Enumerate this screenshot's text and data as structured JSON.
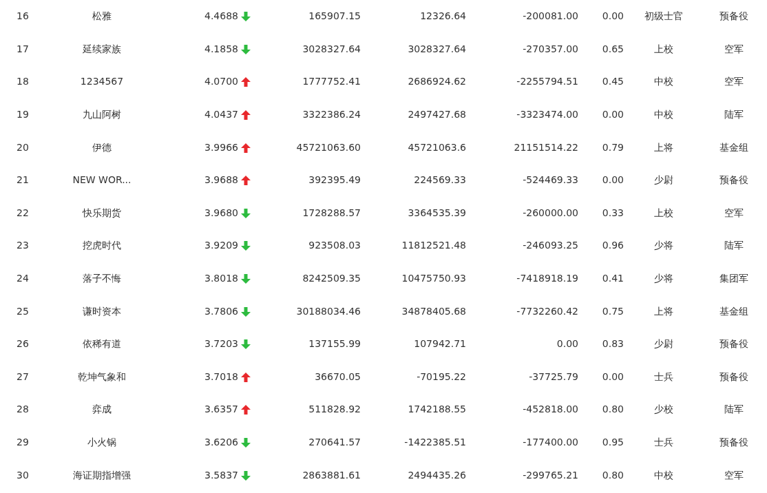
{
  "table": {
    "rows": [
      {
        "rank": "16",
        "name": "松雅",
        "score": "4.4688",
        "rising": false,
        "column_5": "165907.15",
        "column_6": "12326.64",
        "column_7": "-200081.00",
        "column_8": "0.00",
        "column_9": "初级士官",
        "column_10": "预备役"
      },
      {
        "rank": "17",
        "name": "延续家族",
        "score": "4.1858",
        "rising": false,
        "column_5": "3028327.64",
        "column_6": "3028327.64",
        "column_7": "-270357.00",
        "column_8": "0.65",
        "column_9": "上校",
        "column_10": "空军"
      },
      {
        "rank": "18",
        "name": "1234567",
        "score": "4.0700",
        "rising": true,
        "column_5": "1777752.41",
        "column_6": "2686924.62",
        "column_7": "-2255794.51",
        "column_8": "0.45",
        "column_9": "中校",
        "column_10": "空军"
      },
      {
        "rank": "19",
        "name": "九山阿树",
        "score": "4.0437",
        "rising": true,
        "column_5": "3322386.24",
        "column_6": "2497427.68",
        "column_7": "-3323474.00",
        "column_8": "0.00",
        "column_9": "中校",
        "column_10": "陆军"
      },
      {
        "rank": "20",
        "name": "伊德",
        "score": "3.9966",
        "rising": true,
        "column_5": "45721063.60",
        "column_6": "45721063.6",
        "column_7": "21151514.22",
        "column_8": "0.79",
        "column_9": "上将",
        "column_10": "基金组"
      },
      {
        "rank": "21",
        "name": "NEW WOR...",
        "score": "3.9688",
        "rising": true,
        "column_5": "392395.49",
        "column_6": "224569.33",
        "column_7": "-524469.33",
        "column_8": "0.00",
        "column_9": "少尉",
        "column_10": "预备役"
      },
      {
        "rank": "22",
        "name": "快乐期货",
        "score": "3.9680",
        "rising": false,
        "column_5": "1728288.57",
        "column_6": "3364535.39",
        "column_7": "-260000.00",
        "column_8": "0.33",
        "column_9": "上校",
        "column_10": "空军"
      },
      {
        "rank": "23",
        "name": "挖虎时代",
        "score": "3.9209",
        "rising": false,
        "column_5": "923508.03",
        "column_6": "11812521.48",
        "column_7": "-246093.25",
        "column_8": "0.96",
        "column_9": "少将",
        "column_10": "陆军"
      },
      {
        "rank": "24",
        "name": "落子不悔",
        "score": "3.8018",
        "rising": false,
        "column_5": "8242509.35",
        "column_6": "10475750.93",
        "column_7": "-7418918.19",
        "column_8": "0.41",
        "column_9": "少将",
        "column_10": "集团军"
      },
      {
        "rank": "25",
        "name": "谦时资本",
        "score": "3.7806",
        "rising": false,
        "column_5": "30188034.46",
        "column_6": "34878405.68",
        "column_7": "-7732260.42",
        "column_8": "0.75",
        "column_9": "上将",
        "column_10": "基金组"
      },
      {
        "rank": "26",
        "name": "依稀有道",
        "score": "3.7203",
        "rising": false,
        "column_5": "137155.99",
        "column_6": "107942.71",
        "column_7": "0.00",
        "column_8": "0.83",
        "column_9": "少尉",
        "column_10": "预备役"
      },
      {
        "rank": "27",
        "name": "乾坤气象和",
        "score": "3.7018",
        "rising": true,
        "column_5": "36670.05",
        "column_6": "-70195.22",
        "column_7": "-37725.79",
        "column_8": "0.00",
        "column_9": "士兵",
        "column_10": "预备役"
      },
      {
        "rank": "28",
        "name": "弈成",
        "score": "3.6357",
        "rising": true,
        "column_5": "511828.92",
        "column_6": "1742188.55",
        "column_7": "-452818.00",
        "column_8": "0.80",
        "column_9": "少校",
        "column_10": "陆军"
      },
      {
        "rank": "29",
        "name": "小火锅",
        "score": "3.6206",
        "rising": false,
        "column_5": "270641.57",
        "column_6": "-1422385.51",
        "column_7": "-177400.00",
        "column_8": "0.95",
        "column_9": "士兵",
        "column_10": "预备役"
      },
      {
        "rank": "30",
        "name": "海证期指增强",
        "score": "3.5837",
        "rising": false,
        "column_5": "2863881.61",
        "column_6": "2494435.26",
        "column_7": "-299765.21",
        "column_8": "0.80",
        "column_9": "中校",
        "column_10": "空军"
      }
    ]
  }
}
